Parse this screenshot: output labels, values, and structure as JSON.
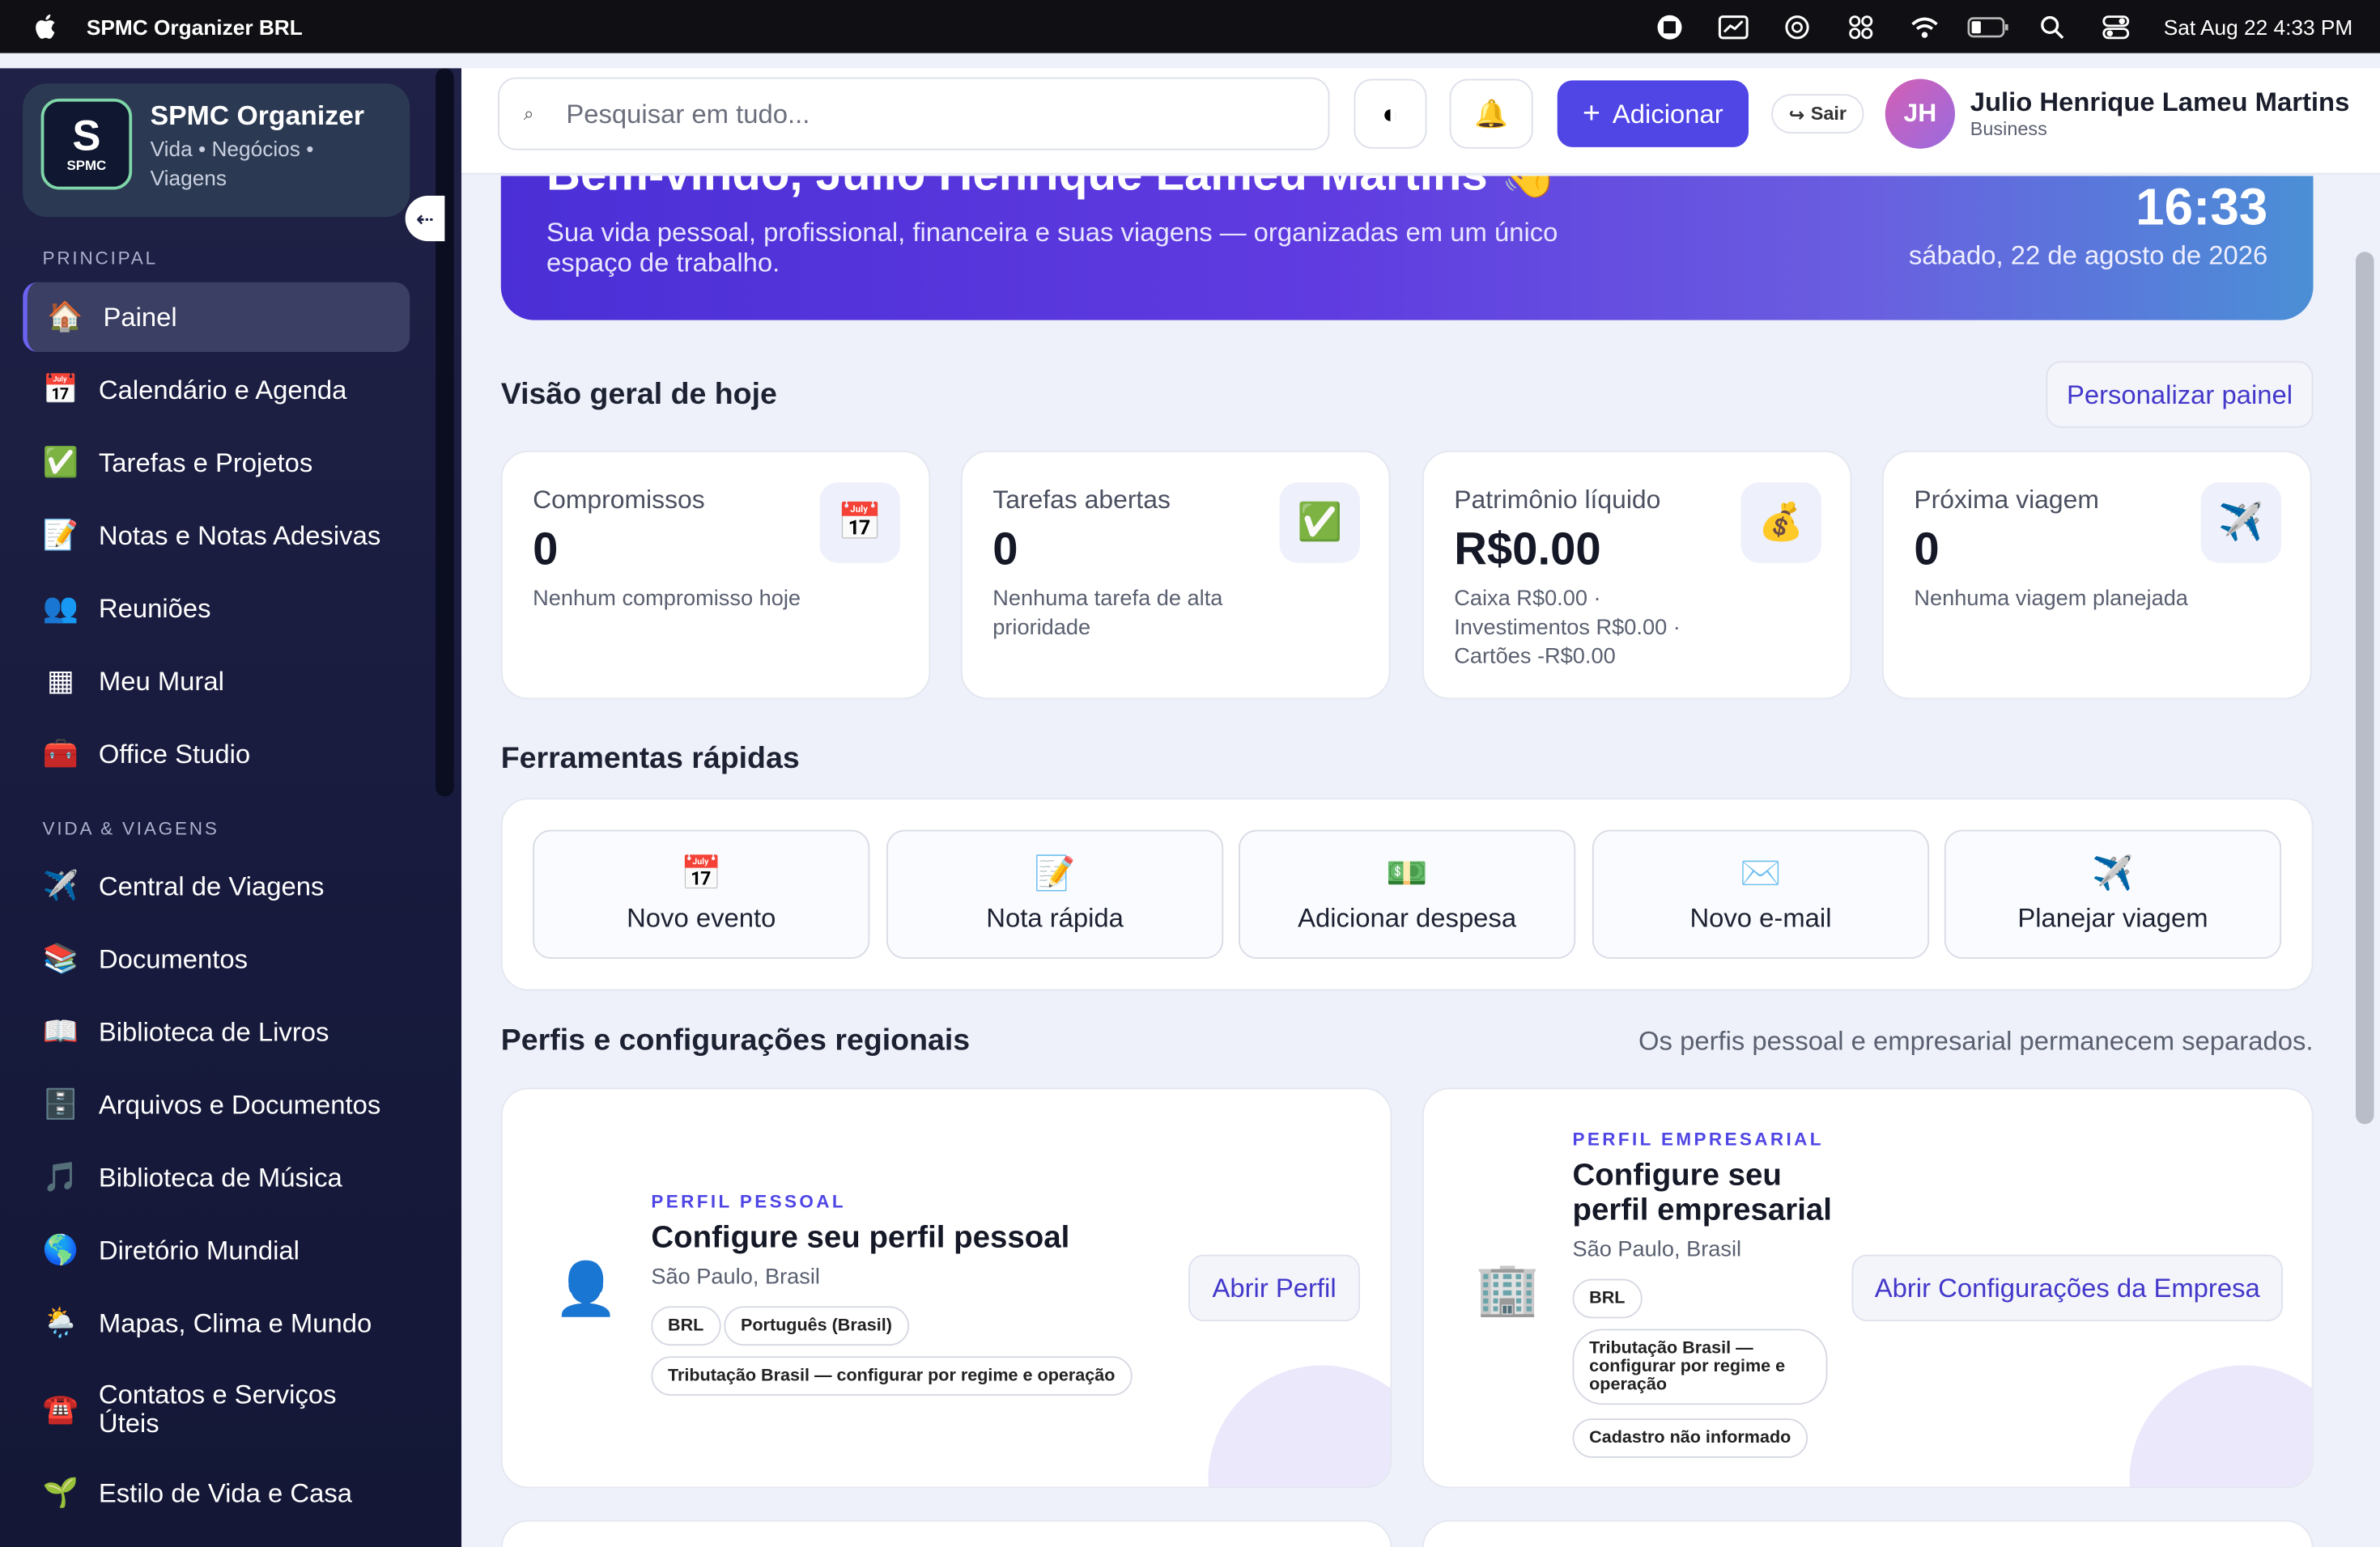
{
  "menubar": {
    "app_name": "SPMC Organizer BRL",
    "datetime": "Sat Aug 22  4:33 PM"
  },
  "sidebar": {
    "brand_title": "SPMC Organizer",
    "brand_subtitle": "Vida • Negócios • Viagens",
    "logo_letter": "S",
    "logo_text": "SPMC",
    "section_principal": "PRINCIPAL",
    "section_vida": "VIDA & VIAGENS",
    "items_principal": [
      {
        "label": "Painel",
        "icon": "home-icon",
        "glyph": "🏠"
      },
      {
        "label": "Calendário e Agenda",
        "icon": "calendar-icon",
        "glyph": "📅"
      },
      {
        "label": "Tarefas e Projetos",
        "icon": "check-icon",
        "glyph": "✅"
      },
      {
        "label": "Notas e Notas Adesivas",
        "icon": "memo-icon",
        "glyph": "📝"
      },
      {
        "label": "Reuniões",
        "icon": "people-icon",
        "glyph": "👥"
      },
      {
        "label": "Meu Mural",
        "icon": "grid-icon",
        "glyph": "▦"
      },
      {
        "label": "Office Studio",
        "icon": "toolbox-icon",
        "glyph": "🧰"
      }
    ],
    "items_vida": [
      {
        "label": "Central de Viagens",
        "icon": "airplane-icon",
        "glyph": "✈️"
      },
      {
        "label": "Documentos",
        "icon": "books-icon",
        "glyph": "📚"
      },
      {
        "label": "Biblioteca de Livros",
        "icon": "book-icon",
        "glyph": "📖"
      },
      {
        "label": "Arquivos e Documentos",
        "icon": "cabinet-icon",
        "glyph": "🗄️"
      },
      {
        "label": "Biblioteca de Música",
        "icon": "music-icon",
        "glyph": "🎵"
      },
      {
        "label": "Diretório Mundial",
        "icon": "globe-icon",
        "glyph": "🌎"
      },
      {
        "label": "Mapas, Clima e Mundo",
        "icon": "weather-icon",
        "glyph": "🌦️"
      },
      {
        "label": "Contatos e Serviços Úteis",
        "icon": "phone-icon",
        "glyph": "☎️"
      },
      {
        "label": "Estilo de Vida e Casa",
        "icon": "sprout-icon",
        "glyph": "🌱"
      }
    ]
  },
  "topbar": {
    "search_placeholder": "Pesquisar em tudo...",
    "add_label": "Adicionar",
    "logout_label": "Sair",
    "avatar_initials": "JH",
    "user_name": "Julio Henrique Lameu Martins",
    "user_role": "Business"
  },
  "hero": {
    "title": "Bem-vindo, Julio Henrique Lameu Martins 👋",
    "subtitle": "Sua vida pessoal, profissional, financeira e suas viagens — organizadas em um único espaço de trabalho.",
    "time": "16:33",
    "date": "sábado, 22 de agosto de 2026"
  },
  "overview": {
    "title": "Visão geral de hoje",
    "customize_label": "Personalizar painel",
    "cards": [
      {
        "label": "Compromissos",
        "value": "0",
        "desc": "Nenhum compromisso hoje",
        "icon": "calendar-icon",
        "glyph": "📅"
      },
      {
        "label": "Tarefas abertas",
        "value": "0",
        "desc": "Nenhuma tarefa de alta prioridade",
        "icon": "check-icon",
        "glyph": "✅"
      },
      {
        "label": "Patrimônio líquido",
        "value": "R$0.00",
        "desc": "Caixa R$0.00 · Investimentos R$0.00 · Cartões -R$0.00",
        "icon": "money-bag-icon",
        "glyph": "💰"
      },
      {
        "label": "Próxima viagem",
        "value": "0",
        "desc": "Nenhuma viagem planejada",
        "icon": "airplane-icon",
        "glyph": "✈️"
      }
    ]
  },
  "tools": {
    "title": "Ferramentas rápidas",
    "items": [
      {
        "label": "Novo evento",
        "icon": "calendar-icon",
        "glyph": "📅"
      },
      {
        "label": "Nota rápida",
        "icon": "memo-icon",
        "glyph": "📝"
      },
      {
        "label": "Adicionar despesa",
        "icon": "money-icon",
        "glyph": "💵"
      },
      {
        "label": "Novo e-mail",
        "icon": "envelope-icon",
        "glyph": "✉️"
      },
      {
        "label": "Planejar viagem",
        "icon": "airplane-icon",
        "glyph": "✈️"
      }
    ]
  },
  "profiles": {
    "title": "Perfis e configurações regionais",
    "note": "Os perfis pessoal e empresarial permanecem separados.",
    "personal": {
      "kicker": "PERFIL PESSOAL",
      "title": "Configure seu perfil pessoal",
      "location": "São Paulo, Brasil",
      "chips": [
        "BRL",
        "Português (Brasil)",
        "Tributação Brasil — configurar por regime e operação"
      ],
      "button": "Abrir Perfil",
      "glyph": "👤"
    },
    "business": {
      "kicker": "PERFIL EMPRESARIAL",
      "title": "Configure seu perfil empresarial",
      "location": "São Paulo, Brasil",
      "chips": [
        "BRL",
        "Tributação Brasil — configurar por regime e operação",
        "Cadastro não informado"
      ],
      "button": "Abrir Configurações da Empresa",
      "glyph": "🏢"
    }
  }
}
